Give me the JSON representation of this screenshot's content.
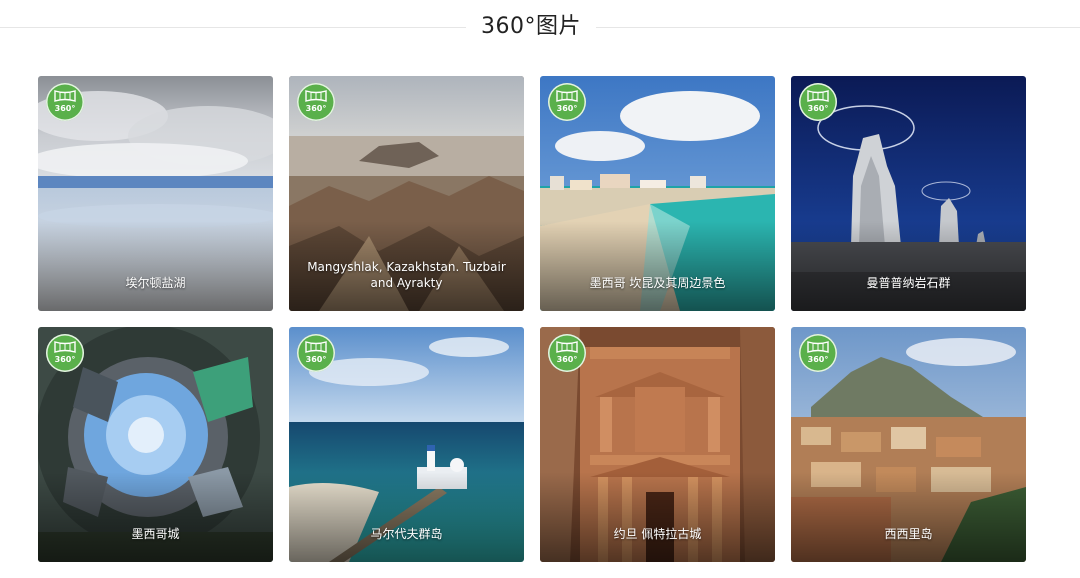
{
  "page": {
    "title": "360°图片"
  },
  "badge_text": "360°",
  "badge_color": "#5ab04b",
  "cards": [
    {
      "label": "埃尔顿盐湖"
    },
    {
      "label": "Mangyshlak, Kazakhstan. Tuzbair and Ayrakty"
    },
    {
      "label": "墨西哥 坎昆及其周边景色"
    },
    {
      "label": "曼普普纳岩石群"
    },
    {
      "label": "墨西哥城"
    },
    {
      "label": "马尔代夫群岛"
    },
    {
      "label": "约旦 佩特拉古城"
    },
    {
      "label": "西西里岛"
    }
  ]
}
